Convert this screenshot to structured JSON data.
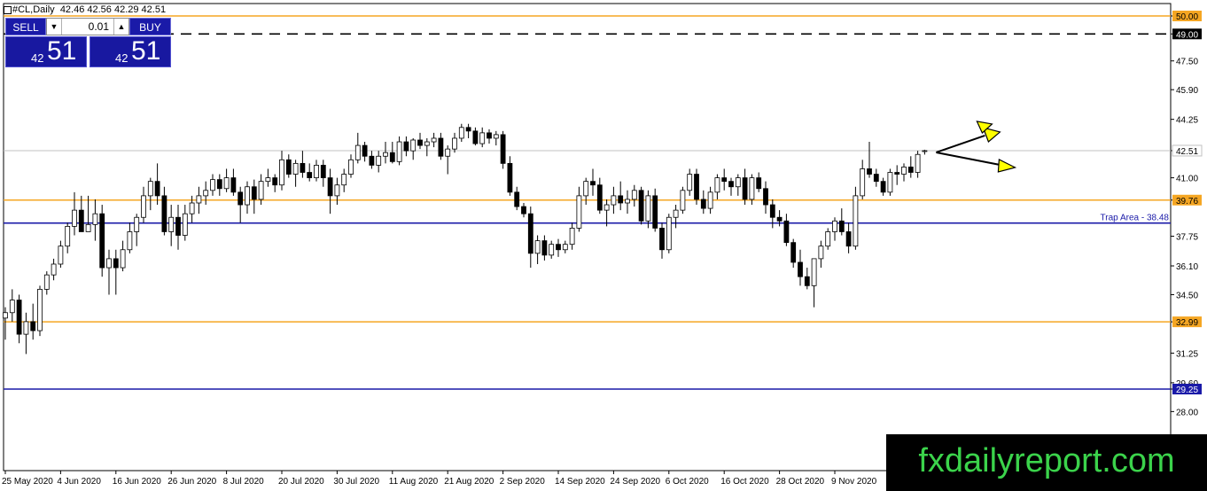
{
  "header": {
    "symbol": "#CL,Daily",
    "ohlc": "42.46 42.56 42.29 42.51"
  },
  "trade_panel": {
    "sell_label": "SELL",
    "buy_label": "BUY",
    "lot_value": "0.01",
    "sell_price_small": "42",
    "sell_price_big": "51",
    "buy_price_small": "42",
    "buy_price_big": "51"
  },
  "watermark": "fxdailyreport.com",
  "chart_data": {
    "type": "candlestick",
    "ylim": [
      26.5,
      51.5
    ],
    "y_ticks": [
      "50.00",
      "49.00",
      "47.50",
      "45.90",
      "44.25",
      "42.51",
      "41.00",
      "39.76",
      "37.75",
      "36.10",
      "34.50",
      "32.99",
      "31.25",
      "29.60",
      "29.25",
      "28.00"
    ],
    "x_ticks": [
      {
        "label": "25 May 2020",
        "i": 0
      },
      {
        "label": "4 Jun 2020",
        "i": 8
      },
      {
        "label": "16 Jun 2020",
        "i": 16
      },
      {
        "label": "26 Jun 2020",
        "i": 24
      },
      {
        "label": "8 Jul 2020",
        "i": 32
      },
      {
        "label": "20 Jul 2020",
        "i": 40
      },
      {
        "label": "30 Jul 2020",
        "i": 48
      },
      {
        "label": "11 Aug 2020",
        "i": 56
      },
      {
        "label": "21 Aug 2020",
        "i": 64
      },
      {
        "label": "2 Sep 2020",
        "i": 72
      },
      {
        "label": "14 Sep 2020",
        "i": 80
      },
      {
        "label": "24 Sep 2020",
        "i": 88
      },
      {
        "label": "6 Oct 2020",
        "i": 96
      },
      {
        "label": "16 Oct 2020",
        "i": 104
      },
      {
        "label": "28 Oct 2020",
        "i": 112
      },
      {
        "label": "9 Nov 2020",
        "i": 120
      }
    ],
    "horizontal_lines": [
      {
        "value": 50.0,
        "color": "#f5a623",
        "style": "solid",
        "label": "50.00"
      },
      {
        "value": 49.0,
        "color": "#000000",
        "style": "dashed",
        "label": "49.00"
      },
      {
        "value": 42.51,
        "color": "#c0c0c0",
        "style": "solid",
        "label": "42.51"
      },
      {
        "value": 39.76,
        "color": "#f5a623",
        "style": "solid",
        "label": "39.76"
      },
      {
        "value": 38.48,
        "color": "#1a1aa8",
        "style": "solid",
        "label": "Trap Area - 38.48"
      },
      {
        "value": 32.99,
        "color": "#f5a623",
        "style": "solid",
        "label": "32.99"
      },
      {
        "value": 29.25,
        "color": "#1a1aa8",
        "style": "solid",
        "label": "29.25"
      }
    ],
    "colors": {
      "bull": "#ffffff",
      "bear": "#000000",
      "orange": "#f5a623",
      "blue": "#1a1aa8",
      "arrow": "#ffff00"
    },
    "candles": [
      [
        33.2,
        33.8,
        32.0,
        33.5
      ],
      [
        33.5,
        34.8,
        33.0,
        34.2
      ],
      [
        34.2,
        34.5,
        31.8,
        32.3
      ],
      [
        32.3,
        33.5,
        31.2,
        33.0
      ],
      [
        33.0,
        34.0,
        32.0,
        32.5
      ],
      [
        32.5,
        35.0,
        32.2,
        34.8
      ],
      [
        34.8,
        35.8,
        34.5,
        35.6
      ],
      [
        35.6,
        36.5,
        35.3,
        36.2
      ],
      [
        36.2,
        37.5,
        36.0,
        37.2
      ],
      [
        37.2,
        38.5,
        36.8,
        38.3
      ],
      [
        38.3,
        40.2,
        37.8,
        39.2
      ],
      [
        39.2,
        40.0,
        38.0,
        38.0
      ],
      [
        38.0,
        40.0,
        38.0,
        38.4
      ],
      [
        38.4,
        39.8,
        37.5,
        39.0
      ],
      [
        39.0,
        39.5,
        35.5,
        36.0
      ],
      [
        36.0,
        37.0,
        34.5,
        36.5
      ],
      [
        36.5,
        37.0,
        34.5,
        36.0
      ],
      [
        36.0,
        37.5,
        35.8,
        37.0
      ],
      [
        37.0,
        38.5,
        36.8,
        38.0
      ],
      [
        38.0,
        39.0,
        37.2,
        38.8
      ],
      [
        38.8,
        40.5,
        38.5,
        40.0
      ],
      [
        40.0,
        41.0,
        39.2,
        40.8
      ],
      [
        40.8,
        41.8,
        39.5,
        40.0
      ],
      [
        40.0,
        40.5,
        37.8,
        38.0
      ],
      [
        38.0,
        39.5,
        37.2,
        38.8
      ],
      [
        38.8,
        39.5,
        37.0,
        37.8
      ],
      [
        37.8,
        39.5,
        37.5,
        39.0
      ],
      [
        39.0,
        40.0,
        38.5,
        39.6
      ],
      [
        39.6,
        40.5,
        39.0,
        40.0
      ],
      [
        40.0,
        40.8,
        39.5,
        40.3
      ],
      [
        40.3,
        41.2,
        40.0,
        40.9
      ],
      [
        40.9,
        41.2,
        40.0,
        40.4
      ],
      [
        40.4,
        41.5,
        40.2,
        41.0
      ],
      [
        41.0,
        41.5,
        40.0,
        40.2
      ],
      [
        40.2,
        40.5,
        38.5,
        39.5
      ],
      [
        39.5,
        40.8,
        39.0,
        40.5
      ],
      [
        40.5,
        40.9,
        39.0,
        39.8
      ],
      [
        39.8,
        41.2,
        39.5,
        40.8
      ],
      [
        40.8,
        41.5,
        40.5,
        41.0
      ],
      [
        41.0,
        41.2,
        40.2,
        40.6
      ],
      [
        40.6,
        42.5,
        40.3,
        42.0
      ],
      [
        42.0,
        42.3,
        41.0,
        41.2
      ],
      [
        41.2,
        42.0,
        40.5,
        41.8
      ],
      [
        41.8,
        42.5,
        41.0,
        41.3
      ],
      [
        41.3,
        41.8,
        40.8,
        41.0
      ],
      [
        41.0,
        42.0,
        40.8,
        41.7
      ],
      [
        41.7,
        42.0,
        40.5,
        41.0
      ],
      [
        41.0,
        41.5,
        39.0,
        40.0
      ],
      [
        40.0,
        41.0,
        39.5,
        40.6
      ],
      [
        40.6,
        41.5,
        40.2,
        41.2
      ],
      [
        41.2,
        42.3,
        41.0,
        42.0
      ],
      [
        42.0,
        43.5,
        41.8,
        42.8
      ],
      [
        42.8,
        43.0,
        41.9,
        42.2
      ],
      [
        42.2,
        42.5,
        41.5,
        41.7
      ],
      [
        41.7,
        42.5,
        41.3,
        42.2
      ],
      [
        42.2,
        43.0,
        41.8,
        42.4
      ],
      [
        42.4,
        43.0,
        41.8,
        41.9
      ],
      [
        41.9,
        43.3,
        41.7,
        43.0
      ],
      [
        43.0,
        43.3,
        42.2,
        42.5
      ],
      [
        42.5,
        43.2,
        42.0,
        43.1
      ],
      [
        43.1,
        43.5,
        42.6,
        42.8
      ],
      [
        42.8,
        43.2,
        42.2,
        43.0
      ],
      [
        43.0,
        43.5,
        42.7,
        43.2
      ],
      [
        43.2,
        43.5,
        42.0,
        42.2
      ],
      [
        42.2,
        42.8,
        41.2,
        42.6
      ],
      [
        42.6,
        43.5,
        42.4,
        43.2
      ],
      [
        43.2,
        44.0,
        43.0,
        43.8
      ],
      [
        43.8,
        44.0,
        43.2,
        43.6
      ],
      [
        43.6,
        43.8,
        42.8,
        42.9
      ],
      [
        42.9,
        43.8,
        42.7,
        43.5
      ],
      [
        43.5,
        43.7,
        42.9,
        43.2
      ],
      [
        43.2,
        43.6,
        42.8,
        43.4
      ],
      [
        43.4,
        43.6,
        41.5,
        41.8
      ],
      [
        41.8,
        42.2,
        40.0,
        40.2
      ],
      [
        40.2,
        40.5,
        39.2,
        39.4
      ],
      [
        39.4,
        39.6,
        38.8,
        39.0
      ],
      [
        39.0,
        39.4,
        36.0,
        36.8
      ],
      [
        36.8,
        37.8,
        36.2,
        37.5
      ],
      [
        37.5,
        37.8,
        36.4,
        36.7
      ],
      [
        36.7,
        37.5,
        36.5,
        37.3
      ],
      [
        37.3,
        37.6,
        36.6,
        37.0
      ],
      [
        37.0,
        37.5,
        36.8,
        37.3
      ],
      [
        37.3,
        38.5,
        37.0,
        38.2
      ],
      [
        38.2,
        40.5,
        38.0,
        40.0
      ],
      [
        40.0,
        41.0,
        39.5,
        40.8
      ],
      [
        40.8,
        41.5,
        40.0,
        40.6
      ],
      [
        40.6,
        41.0,
        39.0,
        39.2
      ],
      [
        39.2,
        39.8,
        38.3,
        39.5
      ],
      [
        39.5,
        40.5,
        39.0,
        40.0
      ],
      [
        40.0,
        40.8,
        39.2,
        39.6
      ],
      [
        39.6,
        40.3,
        39.0,
        39.8
      ],
      [
        39.8,
        40.6,
        39.4,
        40.3
      ],
      [
        40.3,
        40.5,
        38.4,
        38.6
      ],
      [
        38.6,
        40.3,
        38.2,
        40.0
      ],
      [
        40.0,
        40.4,
        38.0,
        38.2
      ],
      [
        38.2,
        38.5,
        36.5,
        37.0
      ],
      [
        37.0,
        39.0,
        36.8,
        38.8
      ],
      [
        38.8,
        39.5,
        38.2,
        39.2
      ],
      [
        39.2,
        40.5,
        39.0,
        40.3
      ],
      [
        40.3,
        41.5,
        40.0,
        41.2
      ],
      [
        41.2,
        41.5,
        39.5,
        39.8
      ],
      [
        39.8,
        40.3,
        39.0,
        39.3
      ],
      [
        39.3,
        40.5,
        39.0,
        40.2
      ],
      [
        40.2,
        41.2,
        39.8,
        41.0
      ],
      [
        41.0,
        41.5,
        40.3,
        40.8
      ],
      [
        40.8,
        41.0,
        40.0,
        40.5
      ],
      [
        40.5,
        41.2,
        40.0,
        41.0
      ],
      [
        41.0,
        41.5,
        39.5,
        39.8
      ],
      [
        39.8,
        41.2,
        39.5,
        41.0
      ],
      [
        41.0,
        41.3,
        40.2,
        40.4
      ],
      [
        40.4,
        40.8,
        39.0,
        39.5
      ],
      [
        39.5,
        39.8,
        38.2,
        38.8
      ],
      [
        38.8,
        39.2,
        38.3,
        38.6
      ],
      [
        38.6,
        39.0,
        37.2,
        37.4
      ],
      [
        37.4,
        37.6,
        36.0,
        36.3
      ],
      [
        36.3,
        37.0,
        35.0,
        35.5
      ],
      [
        35.5,
        36.0,
        34.8,
        35.0
      ],
      [
        35.0,
        35.5,
        33.8,
        36.5
      ],
      [
        36.5,
        37.5,
        36.0,
        37.2
      ],
      [
        37.2,
        38.2,
        37.0,
        38.0
      ],
      [
        38.0,
        38.8,
        37.5,
        38.6
      ],
      [
        38.6,
        39.3,
        37.8,
        38.0
      ],
      [
        38.0,
        38.5,
        36.8,
        37.2
      ],
      [
        37.2,
        40.5,
        37.0,
        40.0
      ],
      [
        40.0,
        42.0,
        39.8,
        41.5
      ],
      [
        41.5,
        43.0,
        41.0,
        41.2
      ],
      [
        41.2,
        41.5,
        40.5,
        40.8
      ],
      [
        40.8,
        41.0,
        40.0,
        40.2
      ],
      [
        40.2,
        41.5,
        40.0,
        41.3
      ],
      [
        41.3,
        41.7,
        40.6,
        41.2
      ],
      [
        41.2,
        41.8,
        40.8,
        41.6
      ],
      [
        41.6,
        42.2,
        41.0,
        41.3
      ],
      [
        41.3,
        42.5,
        41.0,
        42.3
      ],
      [
        42.46,
        42.56,
        42.29,
        42.51
      ]
    ]
  }
}
